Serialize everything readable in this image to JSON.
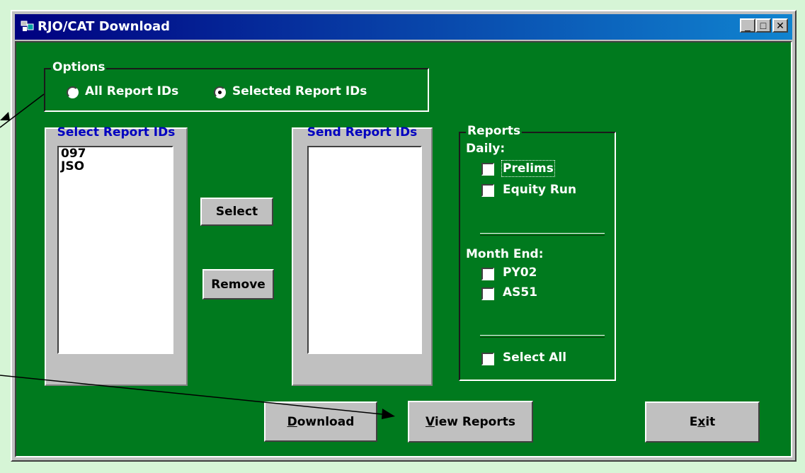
{
  "window": {
    "title": "RJO/CAT Download"
  },
  "titlebar_buttons": {
    "minimize": "_",
    "maximize": "□",
    "close": "✕"
  },
  "options": {
    "legend": "Options",
    "all_label": "All Report IDs",
    "selected_label": "Selected Report IDs",
    "selected_value": "selected"
  },
  "select_panel": {
    "title": "Select Report IDs",
    "items": [
      "097",
      "JSO"
    ]
  },
  "send_panel": {
    "title": "Send Report IDs",
    "items": []
  },
  "buttons": {
    "select": "Select",
    "remove": "Remove",
    "download_u": "D",
    "download_rest": "ownload",
    "view_u": "V",
    "view_rest": "iew Reports",
    "exit_pre": "E",
    "exit_u": "x",
    "exit_rest": "it"
  },
  "reports": {
    "legend": "Reports",
    "daily_label": "Daily:",
    "prelims": "Prelims",
    "equity_run": "Equity Run",
    "month_end_label": "Month End:",
    "py02": "PY02",
    "as51": "AS51",
    "select_all": "Select All"
  },
  "colors": {
    "client_bg": "#007a1e",
    "titlebar": "#000080",
    "panel_title": "#0000c0",
    "page_bg": "#d6f5d6"
  }
}
